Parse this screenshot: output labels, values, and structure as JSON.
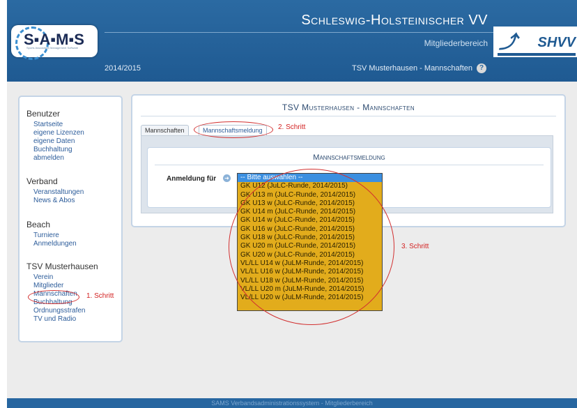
{
  "header": {
    "logo_text": "S▪A▪M▪S",
    "logo_sub": "Sports Association Management Software",
    "season": "2014/2015",
    "title": "Schleswig-Holsteinischer VV",
    "area": "Mitgliederbereich",
    "club_context": "TSV Musterhausen - Mannschaften",
    "help_icon": "?",
    "partner_logo": "SHVV"
  },
  "sidebar": {
    "sections": [
      {
        "heading": "Benutzer",
        "items": [
          "Startseite",
          "eigene Lizenzen",
          "eigene Daten",
          "Buchhaltung",
          "abmelden"
        ]
      },
      {
        "heading": "Verband",
        "items": [
          "Veranstaltungen",
          "News & Abos"
        ]
      },
      {
        "heading": "Beach",
        "items": [
          "Turniere",
          "Anmeldungen"
        ]
      },
      {
        "heading": "TSV Musterhausen",
        "items": [
          "Verein",
          "Mitglieder",
          "Mannschaften",
          "Buchhaltung",
          "Ordnungsstrafen",
          "TV und Radio"
        ]
      }
    ]
  },
  "main": {
    "title": "TSV Musterhausen - Mannschaften",
    "tabs": [
      "Mannschaften",
      "Mannschaftsmeldung"
    ],
    "section_title": "Mannschaftsmeldung",
    "field_label": "Anmeldung für",
    "dropdown_options": [
      "-- Bitte auswählen --",
      "GK U12 (JuLC-Runde, 2014/2015)",
      "GK U13 m (JuLC-Runde, 2014/2015)",
      "GK U13 w (JuLC-Runde, 2014/2015)",
      "GK U14 m (JuLC-Runde, 2014/2015)",
      "GK U14 w (JuLC-Runde, 2014/2015)",
      "GK U16 w (JuLC-Runde, 2014/2015)",
      "GK U18 w (JuLC-Runde, 2014/2015)",
      "GK U20 m (JuLC-Runde, 2014/2015)",
      "GK U20 w (JuLC-Runde, 2014/2015)",
      "VL/LL U14 w (JuLM-Runde, 2014/2015)",
      "VL/LL U16 w (JuLM-Runde, 2014/2015)",
      "VL/LL U18 w (JuLM-Runde, 2014/2015)",
      "VL/LL U20 m (JuLM-Runde, 2014/2015)",
      "VL/LL U20 w (JuLM-Runde, 2014/2015)"
    ]
  },
  "annotations": {
    "step1": "1. Schritt",
    "step2": "2. Schritt",
    "step3": "3. Schritt",
    "color": "#d21f1f"
  },
  "footer": {
    "text": "SAMS Verbandsadministrationssystem - Mitgliederbereich"
  }
}
